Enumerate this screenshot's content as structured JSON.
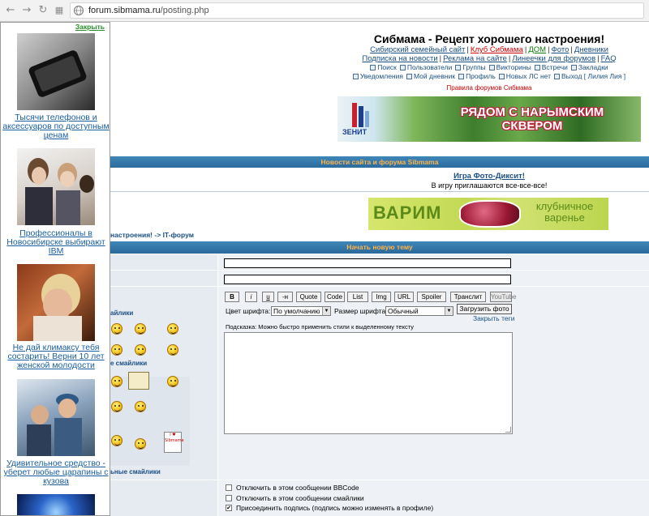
{
  "browser": {
    "url_host": "forum.sibmama.ru",
    "url_path": "/posting.php"
  },
  "ad": {
    "close_label": "Закрыть",
    "items": [
      {
        "caption": "Тысячи телефонов и аксессуаров по доступным ценам",
        "image": "phone-photo"
      },
      {
        "caption": "Профессионалы в Новосибирске выбирают IBM",
        "image": "call-center-photo"
      },
      {
        "caption": "Не дай климаксу тебя состарить! Верни 10 лет женской молодости",
        "image": "tired-woman-photo"
      },
      {
        "caption": "Удивительное средство - уберет любые царапины с кузова",
        "image": "car-mechanics-photo"
      }
    ]
  },
  "header": {
    "title": "Сибмама - Рецепт хорошего настроения!",
    "menu1": [
      {
        "label": "Сибирский семейный сайт",
        "color": "#1a4f86"
      },
      {
        "label": "Клуб Сибмама",
        "color": "#cc0000"
      },
      {
        "label": "ДОМ",
        "color": "#0a7a0a"
      },
      {
        "label": "Фото",
        "color": "#1a4f86"
      },
      {
        "label": "Дневники",
        "color": "#1a4f86"
      }
    ],
    "menu2": [
      "Подписка на новости",
      "Реклама на сайте",
      "Линеечки для форумов",
      "FAQ"
    ],
    "icons1": [
      "Поиск",
      "Пользователи",
      "Группы",
      "Викторины",
      "Встречи",
      "Закладки"
    ],
    "icons2": [
      "Уведомления",
      "Мой дневник",
      "Профиль",
      "Новых ЛС нет",
      "Выход [ Лилия Лия ]"
    ],
    "rules": "Правила форумов Сибмама"
  },
  "banner1": {
    "brand": "ЗЕНИТ",
    "slogan": "РЯДОМ С НАРЫМСКИМ СКВЕРОМ"
  },
  "news": {
    "bar_title": "Новости сайта и форума Sibmama",
    "link": "Игра Фото-Диксит!",
    "sub": "В игру приглашаются все-все-все!"
  },
  "banner2": {
    "word1": "ВАРИМ",
    "word2": "клубничное варенье"
  },
  "breadcrumb": {
    "part1": "настроения!",
    "arrow": "->",
    "part2": "IT-форум"
  },
  "form": {
    "bar_title": "Начать новую тему",
    "bbcode_buttons": [
      "B",
      "i",
      "u",
      "-н",
      "Quote",
      "Code",
      "List",
      "Img",
      "URL",
      "Spoiler",
      "Транслит"
    ],
    "youtube_label": "YouTube",
    "font_color_label": "Цвет шрифта:",
    "font_color_value": "По умолчанию",
    "font_size_label": "Размер шрифта:",
    "font_size_value": "Обычный",
    "upload_label": "Загрузить фото",
    "close_tags_label": "Закрыть теги",
    "hint": "Подсказка: Можно быстро применить стили к выделенному тексту",
    "options": [
      {
        "label": "Отключить в этом сообщении BBCode",
        "checked": false
      },
      {
        "label": "Отключить в этом сообщении смайлики",
        "checked": false
      },
      {
        "label": "Присоединить подпись (подпись можно изменять в профиле)",
        "checked": true
      }
    ]
  },
  "smilies": {
    "title1": "айлики",
    "title2": "е смайлики",
    "title3": "ьные смайлики",
    "sign_text": "I ♥ Sibmama"
  }
}
